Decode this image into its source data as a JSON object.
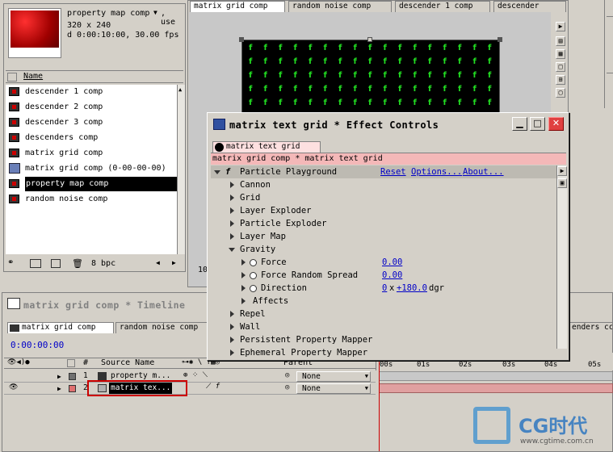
{
  "project": {
    "thumb_title": "property map comp",
    "use_label": ", use",
    "size": "320 x 240",
    "duration": "d 0:00:10:00, 30.00 fps",
    "name_header": "Name",
    "items": [
      "descender 1 comp",
      "descender 2 comp",
      "descender 3 comp",
      "descenders comp",
      "matrix grid comp",
      "matrix grid comp (0-00-00-00)",
      "property map comp",
      "random noise comp"
    ],
    "bpc": "8 bpc",
    "side_number": "10"
  },
  "comp": {
    "tabs": [
      "matrix grid comp",
      "random noise comp",
      "descender 1 comp",
      "descender"
    ],
    "glyph": "f"
  },
  "effect": {
    "title": "matrix text grid * Effect Controls",
    "tab": "matrix text grid",
    "breadcrumb": "matrix grid comp * matrix text grid",
    "plugin": "Particle Playground",
    "reset": "Reset",
    "options": "Options...",
    "about": "About...",
    "groups": [
      "Cannon",
      "Grid",
      "Layer Exploder",
      "Particle Exploder",
      "Layer Map",
      "Gravity"
    ],
    "force_label": "Force",
    "force_value": "0.00",
    "spread_label": "Force Random Spread",
    "spread_value": "0.00",
    "direction_label": "Direction",
    "direction_rev": "0",
    "direction_x": "x",
    "direction_deg": "+180.0",
    "direction_unit": "dgr",
    "affects": "Affects",
    "groups2": [
      "Repel",
      "Wall",
      "Persistent Property Mapper",
      "Ephemeral Property Mapper"
    ]
  },
  "timeline": {
    "title": "matrix grid comp * Timeline",
    "tabs": [
      "matrix grid comp",
      "random noise comp",
      "enders cc"
    ],
    "timecode": "0:00:00:00",
    "col_hash": "#",
    "col_source": "Source Name",
    "col_parent": "Parent",
    "ruler": [
      "00s",
      "01s",
      "02s",
      "03s",
      "04s",
      "05s"
    ],
    "layers": [
      {
        "num": "1",
        "name": "property m...",
        "parent": "None"
      },
      {
        "num": "2",
        "name": "matrix tex...",
        "parent": "None"
      }
    ]
  },
  "watermark": {
    "brand": "CG时代",
    "url": "www.cgtime.com.cn"
  },
  "colors": {
    "accent": "#ff0000",
    "selection": "#000000",
    "pinkbar": "#f4a7a7",
    "timeline_layer": "#e09090"
  }
}
